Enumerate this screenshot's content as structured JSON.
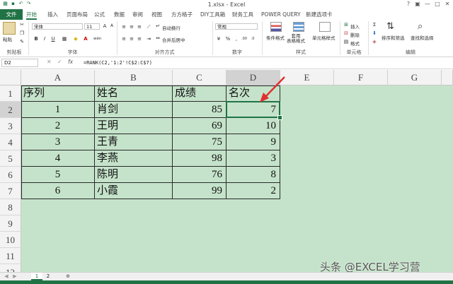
{
  "title": "1.xlsx - Excel",
  "window_controls": [
    "?",
    "▣",
    "—",
    "□",
    "✕"
  ],
  "tabs": [
    "文件",
    "开始",
    "插入",
    "页面布局",
    "公式",
    "数据",
    "审阅",
    "视图",
    "方方格子",
    "DIY工具箱",
    "财务工具",
    "POWER QUERY",
    "新建选项卡"
  ],
  "ribbon": {
    "clipboard": {
      "paste": "粘贴",
      "group": "剪贴板"
    },
    "font": {
      "name": "宋体",
      "size": "11",
      "bold": "B",
      "italic": "I",
      "underline": "U",
      "group": "字体",
      "grow": "A",
      "shrink": "A",
      "wen": "wén"
    },
    "alignment": {
      "wrap": "自动换行",
      "merge": "合并后居中",
      "group": "对齐方式"
    },
    "number": {
      "format": "常规",
      "group": "数字",
      "percent": "%",
      "comma": ",",
      "inc": ".00",
      "dec": ".0"
    },
    "styles": {
      "cond": "条件格式",
      "table": "套用\n表格格式",
      "cell": "单元格样式",
      "group": "样式"
    },
    "cells": {
      "insert": "插入",
      "delete": "删除",
      "format": "格式",
      "group": "单元格"
    },
    "editing": {
      "sort": "排序和筛选",
      "find": "查找和选择",
      "group": "编辑"
    }
  },
  "formula_bar": {
    "namebox": "D2",
    "fx": "fx",
    "formula": "=RANK(C2,'1:2'!C$2:C$7)"
  },
  "columns": [
    "A",
    "B",
    "C",
    "D",
    "E",
    "F",
    "G"
  ],
  "rows": [
    "1",
    "2",
    "3",
    "4",
    "5",
    "6",
    "7",
    "8",
    "9",
    "10",
    "11",
    "12"
  ],
  "table": {
    "headers": [
      "序列",
      "姓名",
      "成绩",
      "名次"
    ],
    "rows": [
      [
        "1",
        "肖剑",
        "85",
        "7"
      ],
      [
        "2",
        "王明",
        "69",
        "10"
      ],
      [
        "3",
        "王青",
        "75",
        "9"
      ],
      [
        "4",
        "李燕",
        "98",
        "3"
      ],
      [
        "5",
        "陈明",
        "76",
        "8"
      ],
      [
        "6",
        "小霞",
        "99",
        "2"
      ]
    ]
  },
  "sheets": [
    "1",
    "2"
  ],
  "watermark": "头条 @EXCEL学习营",
  "colors": {
    "brand": "#217346",
    "cell_bg": "#c5e3ca",
    "arrow": "#e03030"
  }
}
